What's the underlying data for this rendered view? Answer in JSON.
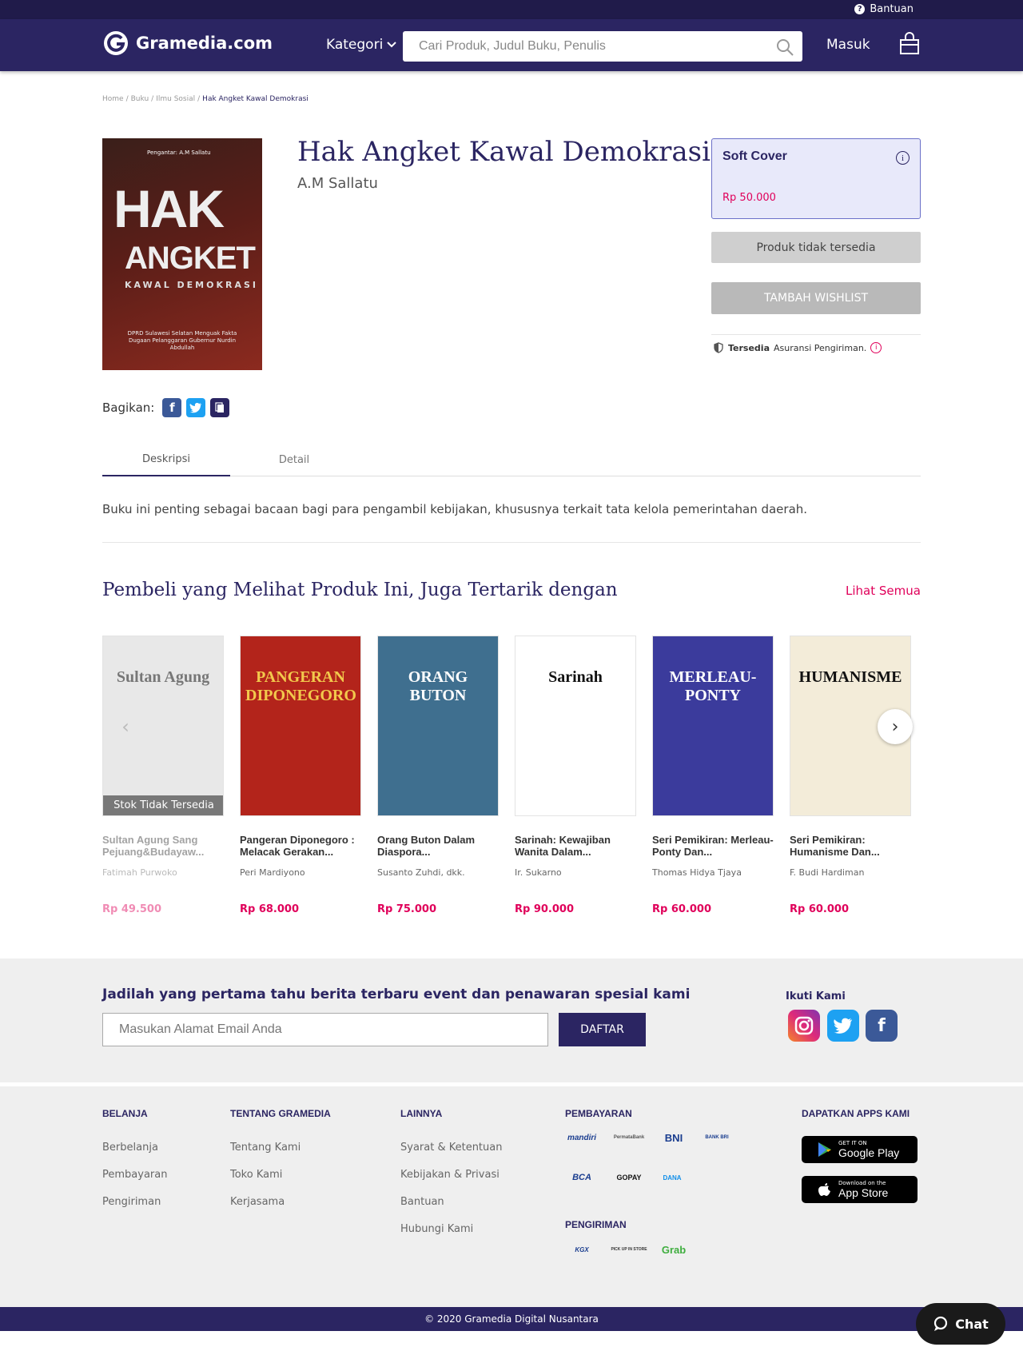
{
  "topbar": {
    "help_label": "Bantuan"
  },
  "header": {
    "brand": "Gramedia.com",
    "category_label": "Kategori",
    "search_placeholder": "Cari Produk, Judul Buku, Penulis",
    "login_label": "Masuk"
  },
  "breadcrumb": [
    "Home",
    "Buku",
    "Ilmu Sosial",
    "Hak Angket Kawal Demokrasi"
  ],
  "product": {
    "title": "Hak Angket Kawal Demokrasi",
    "author": "A.M Sallatu",
    "cover": {
      "intro": "Pengantar: A.M Sallatu",
      "line1": "HAK",
      "line2": "ANGKET",
      "line3": "KAWAL DEMOKRASI",
      "subtitle": "DPRD Sulawesi Selatan Menguak Fakta Dugaan Pelanggaran Gubernur Nurdin Abdullah"
    },
    "format": "Soft Cover",
    "price": "Rp 50.000",
    "unavailable_label": "Produk tidak tersedia",
    "wishlist_label": "TAMBAH WISHLIST",
    "insurance_strong": "Tersedia",
    "insurance_text": "Asuransi Pengiriman."
  },
  "share": {
    "label": "Bagikan:"
  },
  "tabs": [
    {
      "label": "Deskripsi",
      "active": true
    },
    {
      "label": "Detail",
      "active": false
    }
  ],
  "description": "Buku ini penting sebagai bacaan bagi para pengambil kebijakan, khususnya terkait tata kelola pemerintahan daerah.",
  "recommendations": {
    "title": "Pembeli yang Melihat Produk Ini, Juga Tertarik dengan",
    "see_all": "Lihat Semua",
    "out_of_stock_label": "Stok Tidak Tersedia",
    "items": [
      {
        "name": "Sultan Agung Sang Pejuang&Budayaw...",
        "author": "Fatimah Purwoko",
        "price": "Rp 49.500",
        "cover_text": "Sultan Agung",
        "cover_bg": "#e8e8e8",
        "cover_fg": "#777777",
        "out_of_stock": true
      },
      {
        "name": "Pangeran Diponegoro : Melacak Gerakan...",
        "author": "Peri Mardiyono",
        "price": "Rp 68.000",
        "cover_text": "PANGERAN DIPONEGORO",
        "cover_bg": "#b3241b",
        "cover_fg": "#f2c94c",
        "out_of_stock": false
      },
      {
        "name": "Orang Buton Dalam Diaspora...",
        "author": "Susanto Zuhdi, dkk.",
        "price": "Rp 75.000",
        "cover_text": "ORANG BUTON",
        "cover_bg": "#3f6f8f",
        "cover_fg": "#ffffff",
        "out_of_stock": false
      },
      {
        "name": "Sarinah: Kewajiban Wanita Dalam...",
        "author": "Ir. Sukarno",
        "price": "Rp 90.000",
        "cover_text": "Sarinah",
        "cover_bg": "#ffffff",
        "cover_fg": "#111111",
        "out_of_stock": false
      },
      {
        "name": "Seri Pemikiran: Merleau-Ponty Dan...",
        "author": "Thomas Hidya Tjaya",
        "price": "Rp 60.000",
        "cover_text": "MERLEAU-PONTY",
        "cover_bg": "#3b3b9c",
        "cover_fg": "#ffffff",
        "out_of_stock": false
      },
      {
        "name": "Seri Pemikiran: Humanisme Dan...",
        "author": "F. Budi Hardiman",
        "price": "Rp 60.000",
        "cover_text": "HUMANISME",
        "cover_bg": "#f3ecd9",
        "cover_fg": "#111111",
        "out_of_stock": false
      }
    ]
  },
  "newsletter": {
    "title": "Jadilah yang pertama tahu berita terbaru event dan penawaran spesial kami",
    "email_placeholder": "Masukan Alamat Email Anda",
    "button": "DAFTAR",
    "follow_label": "Ikuti Kami"
  },
  "footer": {
    "belanja": {
      "title": "BELANJA",
      "links": [
        "Berbelanja",
        "Pembayaran",
        "Pengiriman"
      ]
    },
    "tentang": {
      "title": "TENTANG GRAMEDIA",
      "links": [
        "Tentang Kami",
        "Toko Kami",
        "Kerjasama"
      ]
    },
    "lainnya": {
      "title": "LAINNYA",
      "links": [
        "Syarat & Ketentuan",
        "Kebijakan & Privasi",
        "Bantuan",
        "Hubungi Kami"
      ]
    },
    "payment_title": "PEMBAYARAN",
    "payments": [
      "mandiri",
      "PermataBank",
      "BNI",
      "BANK BRI",
      "BCA",
      "GOPAY",
      "DANA"
    ],
    "shipping_title": "PENGIRIMAN",
    "shipping": [
      "KGX",
      "PICK UP IN STORE",
      "Grab"
    ],
    "apps_title": "DAPATKAN APPS KAMI",
    "google_small": "GET IT ON",
    "google_big": "Google Play",
    "apple_small": "Download on the",
    "apple_big": "App Store",
    "copyright": "© 2020 Gramedia Digital Nusantara"
  },
  "chat_label": "Chat",
  "colors": {
    "primary": "#2b2562",
    "accent": "#e0005a",
    "topbar": "#201b4a"
  }
}
